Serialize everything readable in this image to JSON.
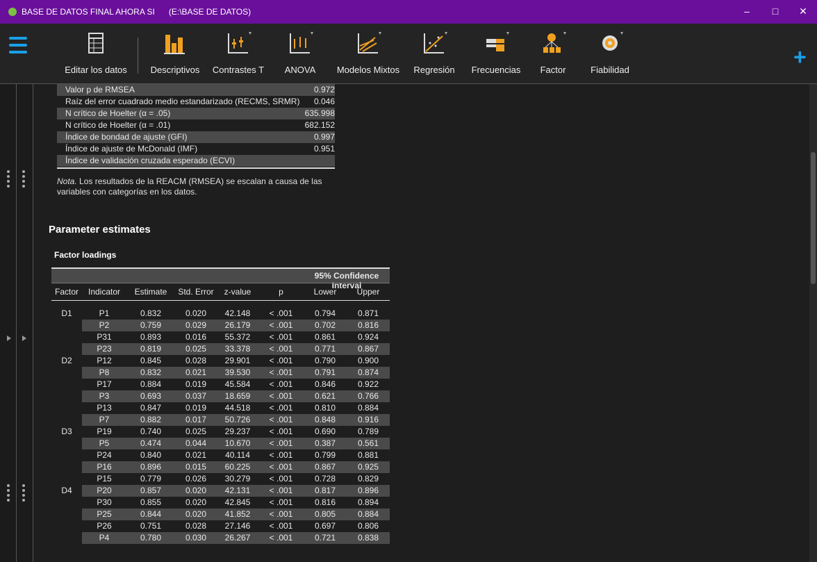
{
  "window": {
    "title": "BASE DE DATOS FINAL AHORA SI",
    "path": "(E:\\BASE DE DATOS)",
    "controls": {
      "minimize": "–",
      "maximize": "□",
      "close": "✕"
    }
  },
  "toolbar": {
    "menu_icon": "hamburger-menu-icon",
    "add_icon": "plus-icon",
    "items": [
      {
        "label": "Editar los datos",
        "icon": "spreadsheet-icon"
      },
      {
        "label": "Descriptivos",
        "icon": "bar-chart-icon"
      },
      {
        "label": "Contrastes T",
        "icon": "t-test-icon"
      },
      {
        "label": "ANOVA",
        "icon": "anova-icon"
      },
      {
        "label": "Modelos Mixtos",
        "icon": "mixed-models-icon"
      },
      {
        "label": "Regresión",
        "icon": "regression-icon"
      },
      {
        "label": "Frecuencias",
        "icon": "frequencies-icon"
      },
      {
        "label": "Factor",
        "icon": "factor-icon"
      },
      {
        "label": "Fiabilidad",
        "icon": "reliability-icon"
      }
    ]
  },
  "fit_table": {
    "rows": [
      {
        "label": "Valor p de RMSEA",
        "value": "0.972"
      },
      {
        "label": "Raíz del error cuadrado medio estandarizado (RECMS, SRMR)",
        "value": "0.046"
      },
      {
        "label": "N crítico de Hoelter (α = .05)",
        "value": "635.998"
      },
      {
        "label": "N crítico de Hoelter (α = .01)",
        "value": "682.152"
      },
      {
        "label": "Índice de bondad de ajuste (GFI)",
        "value": "0.997"
      },
      {
        "label": "Índice de ajuste de McDonald (IMF)",
        "value": "0.951"
      },
      {
        "label": "Índice de validación cruzada esperado (ECVI)",
        "value": ""
      }
    ],
    "note_label": "Nota.",
    "note_text": " Los resultados de la REACM (RMSEA) se escalan a causa de las variables con categorías en los datos."
  },
  "parameter_estimates": {
    "title": "Parameter estimates",
    "factor_loadings": {
      "title": "Factor loadings",
      "ci_header": "95% Confidence Interval",
      "columns": [
        "Factor",
        "Indicator",
        "Estimate",
        "Std. Error",
        "z-value",
        "p",
        "Lower",
        "Upper"
      ],
      "rows": [
        [
          "D1",
          "P1",
          "0.832",
          "0.020",
          "42.148",
          "< .001",
          "0.794",
          "0.871"
        ],
        [
          "",
          "P2",
          "0.759",
          "0.029",
          "26.179",
          "< .001",
          "0.702",
          "0.816"
        ],
        [
          "",
          "P31",
          "0.893",
          "0.016",
          "55.372",
          "< .001",
          "0.861",
          "0.924"
        ],
        [
          "",
          "P23",
          "0.819",
          "0.025",
          "33.378",
          "< .001",
          "0.771",
          "0.867"
        ],
        [
          "D2",
          "P12",
          "0.845",
          "0.028",
          "29.901",
          "< .001",
          "0.790",
          "0.900"
        ],
        [
          "",
          "P8",
          "0.832",
          "0.021",
          "39.530",
          "< .001",
          "0.791",
          "0.874"
        ],
        [
          "",
          "P17",
          "0.884",
          "0.019",
          "45.584",
          "< .001",
          "0.846",
          "0.922"
        ],
        [
          "",
          "P3",
          "0.693",
          "0.037",
          "18.659",
          "< .001",
          "0.621",
          "0.766"
        ],
        [
          "",
          "P13",
          "0.847",
          "0.019",
          "44.518",
          "< .001",
          "0.810",
          "0.884"
        ],
        [
          "",
          "P7",
          "0.882",
          "0.017",
          "50.726",
          "< .001",
          "0.848",
          "0.916"
        ],
        [
          "D3",
          "P19",
          "0.740",
          "0.025",
          "29.237",
          "< .001",
          "0.690",
          "0.789"
        ],
        [
          "",
          "P5",
          "0.474",
          "0.044",
          "10.670",
          "< .001",
          "0.387",
          "0.561"
        ],
        [
          "",
          "P24",
          "0.840",
          "0.021",
          "40.114",
          "< .001",
          "0.799",
          "0.881"
        ],
        [
          "",
          "P16",
          "0.896",
          "0.015",
          "60.225",
          "< .001",
          "0.867",
          "0.925"
        ],
        [
          "",
          "P15",
          "0.779",
          "0.026",
          "30.279",
          "< .001",
          "0.728",
          "0.829"
        ],
        [
          "D4",
          "P20",
          "0.857",
          "0.020",
          "42.131",
          "< .001",
          "0.817",
          "0.896"
        ],
        [
          "",
          "P30",
          "0.855",
          "0.020",
          "42.845",
          "< .001",
          "0.816",
          "0.894"
        ],
        [
          "",
          "P25",
          "0.844",
          "0.020",
          "41.852",
          "< .001",
          "0.805",
          "0.884"
        ],
        [
          "",
          "P26",
          "0.751",
          "0.028",
          "27.146",
          "< .001",
          "0.697",
          "0.806"
        ],
        [
          "",
          "P4",
          "0.780",
          "0.030",
          "26.267",
          "< .001",
          "0.721",
          "0.838"
        ]
      ]
    }
  },
  "colors": {
    "titlebar": "#6a0f9c",
    "accent": "#1aa0e8",
    "icon_orange": "#f0a020",
    "background": "#1e1e1e"
  }
}
